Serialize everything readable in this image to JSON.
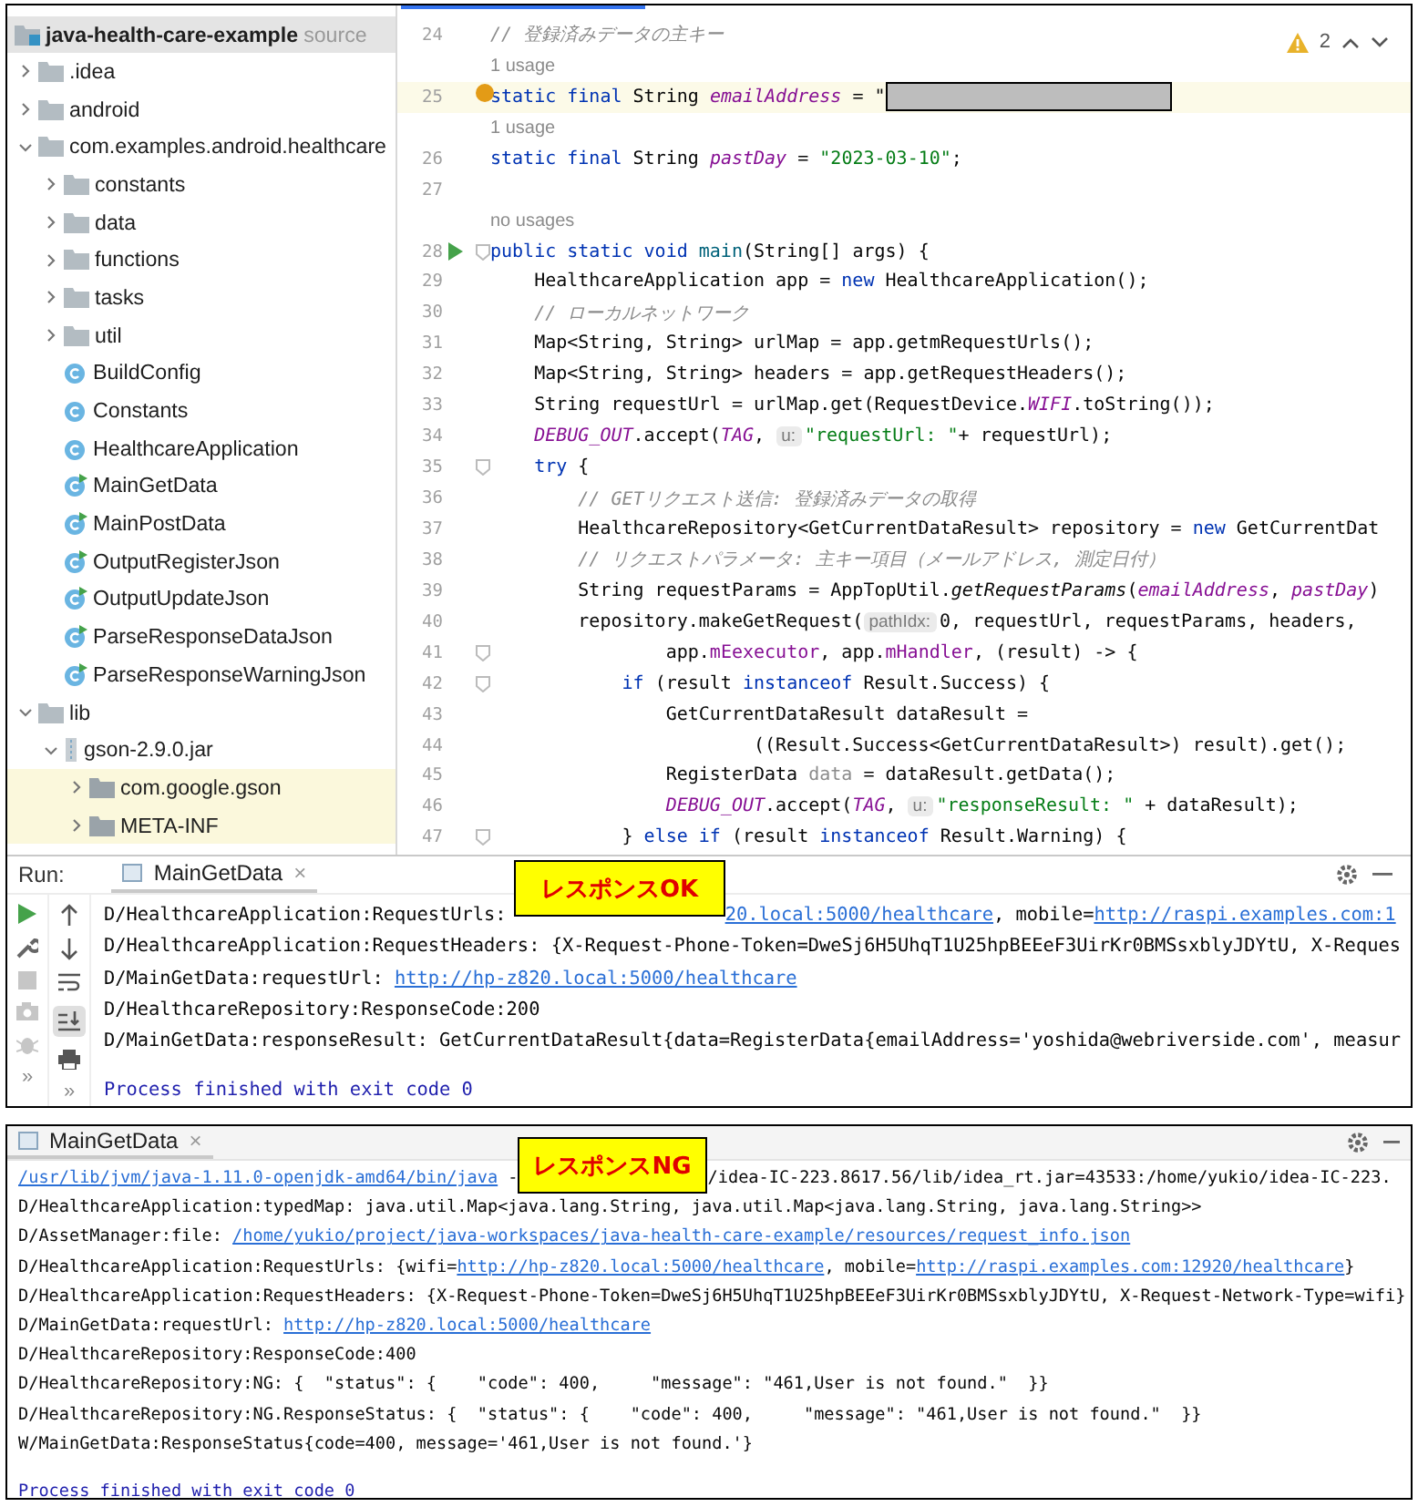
{
  "project_tree": {
    "title": "java-health-care-example",
    "suffix": "source",
    "items": [
      {
        "name": ".idea",
        "kind": "folder",
        "expanded": false,
        "highlighted": false
      },
      {
        "name": "android",
        "kind": "folder",
        "expanded": false,
        "highlighted": false
      },
      {
        "name": "com.examples.android.healthcare",
        "kind": "folder",
        "expanded": true,
        "highlighted": false,
        "children": [
          {
            "name": "constants",
            "kind": "folder",
            "expanded": false,
            "highlighted": false
          },
          {
            "name": "data",
            "kind": "folder",
            "expanded": false,
            "highlighted": false
          },
          {
            "name": "functions",
            "kind": "folder",
            "expanded": false,
            "highlighted": false
          },
          {
            "name": "tasks",
            "kind": "folder",
            "expanded": false,
            "highlighted": false
          },
          {
            "name": "util",
            "kind": "folder",
            "expanded": false,
            "highlighted": false
          },
          {
            "name": "BuildConfig",
            "kind": "class",
            "highlighted": false
          },
          {
            "name": "Constants",
            "kind": "class",
            "highlighted": false
          },
          {
            "name": "HealthcareApplication",
            "kind": "class",
            "highlighted": false
          },
          {
            "name": "MainGetData",
            "kind": "main-class",
            "highlighted": false
          },
          {
            "name": "MainPostData",
            "kind": "main-class",
            "highlighted": false
          },
          {
            "name": "OutputRegisterJson",
            "kind": "main-class",
            "highlighted": false
          },
          {
            "name": "OutputUpdateJson",
            "kind": "main-class",
            "highlighted": false
          },
          {
            "name": "ParseResponseDataJson",
            "kind": "main-class",
            "highlighted": false
          },
          {
            "name": "ParseResponseWarningJson",
            "kind": "main-class",
            "highlighted": false
          }
        ]
      },
      {
        "name": "lib",
        "kind": "folder",
        "expanded": true,
        "highlighted": false,
        "children": [
          {
            "name": "gson-2.9.0.jar",
            "kind": "jar",
            "expanded": true,
            "highlighted": false,
            "children": [
              {
                "name": "com.google.gson",
                "kind": "package",
                "expanded": false,
                "highlighted": true
              },
              {
                "name": "META-INF",
                "kind": "package",
                "expanded": false,
                "highlighted": true
              }
            ]
          }
        ]
      }
    ]
  },
  "editor": {
    "warning_count": "2",
    "lines": [
      {
        "number": "24",
        "current": false,
        "fold": false,
        "tokens": [
          {
            "kind": "cm",
            "text": "// 登録済みデータの主キー"
          }
        ]
      },
      {
        "number": "25",
        "usage_hint": "1 usage",
        "current": true,
        "fold": false,
        "marker": {
          "kind": "dot"
        },
        "tokens": [
          {
            "kind": "kw",
            "text": "static final "
          },
          {
            "kind": "p",
            "text": "String "
          },
          {
            "kind": "fld",
            "text": "emailAddress"
          },
          {
            "kind": "p",
            "text": " = \""
          },
          {
            "kind": "redacted"
          }
        ]
      },
      {
        "number": "26",
        "usage_hint": "1 usage",
        "current": false,
        "fold": false,
        "tokens": [
          {
            "kind": "kw",
            "text": "static final "
          },
          {
            "kind": "p",
            "text": "String "
          },
          {
            "kind": "fld",
            "text": "pastDay"
          },
          {
            "kind": "p",
            "text": " = "
          },
          {
            "kind": "str",
            "text": "\"2023-03-10\""
          },
          {
            "kind": "p",
            "text": ";"
          }
        ]
      },
      {
        "number": "27",
        "current": false,
        "fold": false
      },
      {
        "number": "28",
        "usage_hint": "no usages",
        "current": false,
        "fold": true,
        "marker": {
          "kind": "run"
        },
        "tokens": [
          {
            "kind": "kw",
            "text": "public static void "
          },
          {
            "kind": "fn",
            "text": "main"
          },
          {
            "kind": "p",
            "text": "(String[] args) {"
          }
        ]
      },
      {
        "number": "29",
        "current": false,
        "fold": false,
        "tokens": [
          {
            "kind": "p",
            "text": "    HealthcareApplication app = "
          },
          {
            "kind": "kw",
            "text": "new "
          },
          {
            "kind": "p",
            "text": "HealthcareApplication();"
          }
        ]
      },
      {
        "number": "30",
        "current": false,
        "fold": false,
        "tokens": [
          {
            "kind": "cm",
            "text": "    // ローカルネットワーク"
          }
        ]
      },
      {
        "number": "31",
        "current": false,
        "fold": false,
        "tokens": [
          {
            "kind": "p",
            "text": "    Map<String, String> urlMap = app.getmRequestUrls();"
          }
        ]
      },
      {
        "number": "32",
        "current": false,
        "fold": false,
        "tokens": [
          {
            "kind": "p",
            "text": "    Map<String, String> headers = app.getRequestHeaders();"
          }
        ]
      },
      {
        "number": "33",
        "current": false,
        "fold": false,
        "tokens": [
          {
            "kind": "p",
            "text": "    String requestUrl = urlMap.get(RequestDevice."
          },
          {
            "kind": "st",
            "text": "WIFI"
          },
          {
            "kind": "p",
            "text": ".toString());"
          }
        ]
      },
      {
        "number": "34",
        "current": false,
        "fold": false,
        "tokens": [
          {
            "kind": "st",
            "text": "    DEBUG_OUT"
          },
          {
            "kind": "p",
            "text": ".accept("
          },
          {
            "kind": "st",
            "text": "TAG"
          },
          {
            "kind": "p",
            "text": ", "
          },
          {
            "kind": "hint",
            "text": "u:"
          },
          {
            "kind": "str",
            "text": "\"requestUrl: \""
          },
          {
            "kind": "p",
            "text": "+ requestUrl);"
          }
        ]
      },
      {
        "number": "35",
        "current": false,
        "fold": true,
        "tokens": [
          {
            "kind": "kw",
            "text": "    try "
          },
          {
            "kind": "p",
            "text": "{"
          }
        ]
      },
      {
        "number": "36",
        "current": false,
        "fold": false,
        "tokens": [
          {
            "kind": "cm",
            "text": "        // GETリクエスト送信: 登録済みデータの取得"
          }
        ]
      },
      {
        "number": "37",
        "current": false,
        "fold": false,
        "tokens": [
          {
            "kind": "p",
            "text": "        HealthcareRepository<GetCurrentDataResult> repository = "
          },
          {
            "kind": "kw",
            "text": "new "
          },
          {
            "kind": "p",
            "text": "GetCurrentDat"
          }
        ]
      },
      {
        "number": "38",
        "current": false,
        "fold": false,
        "tokens": [
          {
            "kind": "cm",
            "text": "        // リクエストパラメータ: 主キー項目（メールアドレス, 測定日付）"
          }
        ]
      },
      {
        "number": "39",
        "current": false,
        "fold": false,
        "tokens": [
          {
            "kind": "p",
            "text": "        String requestParams = AppTopUtil."
          },
          {
            "kind": "mi",
            "text": "getRequestParams"
          },
          {
            "kind": "p",
            "text": "("
          },
          {
            "kind": "fld",
            "text": "emailAddress"
          },
          {
            "kind": "p",
            "text": ", "
          },
          {
            "kind": "fld",
            "text": "pastDay"
          },
          {
            "kind": "p",
            "text": ")"
          }
        ]
      },
      {
        "number": "40",
        "current": false,
        "fold": false,
        "tokens": [
          {
            "kind": "p",
            "text": "        repository.makeGetRequest("
          },
          {
            "kind": "hint",
            "text": "pathIdx:"
          },
          {
            "kind": "p",
            "text": "0, requestUrl, requestParams, headers,"
          }
        ]
      },
      {
        "number": "41",
        "current": false,
        "fold": true,
        "tokens": [
          {
            "kind": "p",
            "text": "                app."
          },
          {
            "kind": "ifld",
            "text": "mEexecutor"
          },
          {
            "kind": "p",
            "text": ", app."
          },
          {
            "kind": "ifld",
            "text": "mHandler"
          },
          {
            "kind": "p",
            "text": ", (result) -> {"
          }
        ]
      },
      {
        "number": "42",
        "current": false,
        "fold": true,
        "tokens": [
          {
            "kind": "kw",
            "text": "            if "
          },
          {
            "kind": "p",
            "text": "(result "
          },
          {
            "kind": "kw",
            "text": "instanceof "
          },
          {
            "kind": "p",
            "text": "Result.Success) {"
          }
        ]
      },
      {
        "number": "43",
        "current": false,
        "fold": false,
        "tokens": [
          {
            "kind": "p",
            "text": "                GetCurrentDataResult dataResult ="
          }
        ]
      },
      {
        "number": "44",
        "current": false,
        "fold": false,
        "tokens": [
          {
            "kind": "p",
            "text": "                        ((Result.Success<GetCurrentDataResult>) result).get();"
          }
        ]
      },
      {
        "number": "45",
        "current": false,
        "fold": false,
        "tokens": [
          {
            "kind": "p",
            "text": "                RegisterData "
          },
          {
            "kind": "unused",
            "text": "data"
          },
          {
            "kind": "p",
            "text": " = dataResult.getData();"
          }
        ]
      },
      {
        "number": "46",
        "current": false,
        "fold": false,
        "tokens": [
          {
            "kind": "st",
            "text": "                DEBUG_OUT"
          },
          {
            "kind": "p",
            "text": ".accept("
          },
          {
            "kind": "st",
            "text": "TAG"
          },
          {
            "kind": "p",
            "text": ", "
          },
          {
            "kind": "hint",
            "text": "u:"
          },
          {
            "kind": "str",
            "text": "\"responseResult: \""
          },
          {
            "kind": "p",
            "text": " + dataResult);"
          }
        ]
      },
      {
        "number": "47",
        "current": false,
        "fold": true,
        "tokens": [
          {
            "kind": "p",
            "text": "            } "
          },
          {
            "kind": "kw",
            "text": "else if "
          },
          {
            "kind": "p",
            "text": "(result "
          },
          {
            "kind": "kw",
            "text": "instanceof "
          },
          {
            "kind": "p",
            "text": "Result.Warning) {"
          }
        ]
      }
    ]
  },
  "run_panel": {
    "label": "Run:",
    "tab": {
      "title": "MainGetData",
      "close": "×"
    },
    "badge": "レスポンスOK",
    "scroll_to_end": true,
    "more": [
      "»",
      "»"
    ],
    "lines": [
      {
        "kind": "log",
        "segments": [
          {
            "kind": "t",
            "text": "D/HealthcareApplication:RequestUrls:"
          },
          {
            "kind": "gap"
          },
          {
            "kind": "link",
            "text": "20.local:5000/healthcare"
          },
          {
            "kind": "t",
            "text": ", mobile="
          },
          {
            "kind": "link",
            "text": "http://raspi.examples.com:1"
          }
        ]
      },
      {
        "kind": "log",
        "segments": [
          {
            "kind": "t",
            "text": "D/HealthcareApplication:RequestHeaders: {X-Request-Phone-Token=DweSj6H5UhqT1U25hpBEEeF3UirKr0BMSsxblyJDYtU, X-Reques"
          }
        ]
      },
      {
        "kind": "log",
        "segments": [
          {
            "kind": "t",
            "text": "D/MainGetData:requestUrl: "
          },
          {
            "kind": "link",
            "text": "http://hp-z820.local:5000/healthcare"
          }
        ]
      },
      {
        "kind": "log",
        "segments": [
          {
            "kind": "t",
            "text": "D/HealthcareRepository:ResponseCode:200"
          }
        ]
      },
      {
        "kind": "log",
        "segments": [
          {
            "kind": "t",
            "text": "D/MainGetData:responseResult: GetCurrentDataResult{data=RegisterData{emailAddress='yoshida@webriverside.com', measur"
          }
        ]
      },
      {
        "kind": "exit",
        "segments": [
          {
            "kind": "t",
            "text": "Process finished with exit code 0"
          }
        ]
      }
    ]
  },
  "console_panel": {
    "tab": {
      "title": "MainGetData",
      "close": "×"
    },
    "badge": "レスポンスNG",
    "lines": [
      {
        "kind": "log",
        "segments": [
          {
            "kind": "link",
            "text": "/usr/lib/jvm/java-1.11.0-openjdk-amd64/bin/java"
          },
          {
            "kind": "t",
            "text": " -"
          },
          {
            "kind": "gap"
          },
          {
            "kind": "t",
            "text": "/idea-IC-223.8617.56/lib/idea_rt.jar=43533:/home/yukio/idea-IC-223."
          }
        ]
      },
      {
        "kind": "log",
        "segments": [
          {
            "kind": "t",
            "text": "D/HealthcareApplication:typedMap: java.util.Map<java.lang.String, java.util.Map<java.lang.String, java.lang.String>>"
          }
        ]
      },
      {
        "kind": "log",
        "segments": [
          {
            "kind": "t",
            "text": "D/AssetManager:file: "
          },
          {
            "kind": "link",
            "text": "/home/yukio/project/java-workspaces/java-health-care-example/resources/request_info.json"
          }
        ]
      },
      {
        "kind": "log",
        "segments": [
          {
            "kind": "t",
            "text": "D/HealthcareApplication:RequestUrls: {wifi="
          },
          {
            "kind": "link",
            "text": "http://hp-z820.local:5000/healthcare"
          },
          {
            "kind": "t",
            "text": ", mobile="
          },
          {
            "kind": "link",
            "text": "http://raspi.examples.com:12920/healthcare"
          },
          {
            "kind": "t",
            "text": "}"
          }
        ]
      },
      {
        "kind": "log",
        "segments": [
          {
            "kind": "t",
            "text": "D/HealthcareApplication:RequestHeaders: {X-Request-Phone-Token=DweSj6H5UhqT1U25hpBEEeF3UirKr0BMSsxblyJDYtU, X-Request-Network-Type=wifi}"
          }
        ]
      },
      {
        "kind": "log",
        "segments": [
          {
            "kind": "t",
            "text": "D/MainGetData:requestUrl: "
          },
          {
            "kind": "link",
            "text": "http://hp-z820.local:5000/healthcare"
          }
        ]
      },
      {
        "kind": "log",
        "segments": [
          {
            "kind": "t",
            "text": "D/HealthcareRepository:ResponseCode:400"
          }
        ]
      },
      {
        "kind": "log",
        "segments": [
          {
            "kind": "t",
            "text": "D/HealthcareRepository:NG: {  \"status\": {    \"code\": 400,     \"message\": \"461,User is not found.\"  }}"
          }
        ]
      },
      {
        "kind": "log",
        "segments": [
          {
            "kind": "t",
            "text": "D/HealthcareRepository:NG.ResponseStatus: {  \"status\": {    \"code\": 400,     \"message\": \"461,User is not found.\"  }}"
          }
        ]
      },
      {
        "kind": "log",
        "segments": [
          {
            "kind": "t",
            "text": "W/MainGetData:ResponseStatus{code=400, message='461,User is not found.'}"
          }
        ]
      },
      {
        "kind": "exit",
        "segments": [
          {
            "kind": "t",
            "text": "Process finished with exit code 0"
          }
        ]
      }
    ]
  }
}
